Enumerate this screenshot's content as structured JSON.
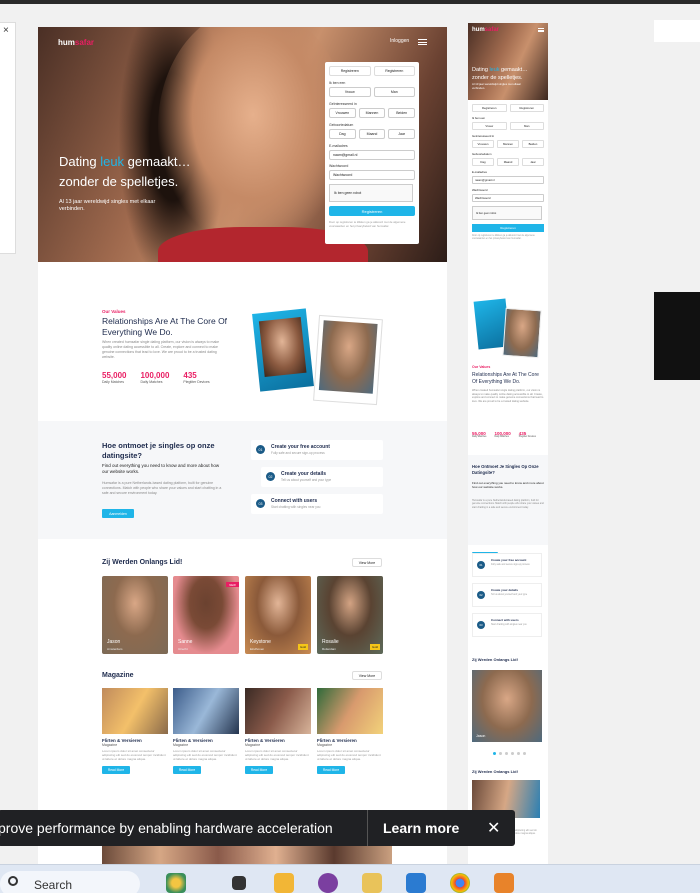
{
  "browser": {
    "close_glyph": "×"
  },
  "site": {
    "logo_main": "hum",
    "logo_accent": "safar",
    "login_label": "Inloggen",
    "hero_title_pre": "Dating ",
    "hero_title_highlight": "leuk",
    "hero_title_post": " gemaakt…",
    "hero_title_line2": "zonder de spelletjes.",
    "hero_sub": "Al 13 jaar wereldwijd singles met elkaar verbinden.",
    "form": {
      "social_btn_1": "Registreren",
      "social_btn_2": "Registreren",
      "label_iam": "Ik ben een",
      "iam_options": [
        "Vrouw",
        "Man"
      ],
      "label_interested": "Geïnteresseerd in",
      "interested_options": [
        "Vrouwen",
        "Mannen",
        "Beiden"
      ],
      "label_dob": "Geboortedatum",
      "dob_day": "Dag",
      "dob_month": "Maand",
      "dob_year": "Jaar",
      "label_email": "E-mailadres",
      "email_value": "naam@gmail.nl",
      "label_password": "Wachtwoord",
      "password_value": "Wachtwoord",
      "captcha_label": "Ik ben geen robot",
      "register_label": "Registreren",
      "fine_print": "Door op registreren te klikken ga je akkoord met de algemene voorwaarden en het privacybeleid van humsafar."
    },
    "values": {
      "eyebrow": "Our Values",
      "title": "Relationships Are At The Core Of Everything We Do.",
      "text": "When created humsafar single dating platform, our vision is always to make quality online dating accessible to all. Create, explore and connect to make genuine connections that lead to love. We are proud to be a trusted dating website.",
      "stats": [
        {
          "num": "55,000",
          "label": "Daily Matches"
        },
        {
          "num": "100,000",
          "label": "Daily Matches"
        },
        {
          "num": "435",
          "label": "Plegtiter Devices"
        }
      ]
    },
    "how": {
      "title": "Hoe ontmoet je singles op onze datingsite?",
      "lead": "Find out everything you need to know and more about how our website works.",
      "text": "Humsafar is a pure Netherlands-based dating platform, built for genuine connections. Match with people who share your values and start chatting in a safe and secure environment today.",
      "button": "Aanmelden",
      "steps": [
        {
          "n": "01",
          "title": "Create your free account",
          "desc": "Fully safe and secure sign-up process"
        },
        {
          "n": "02",
          "title": "Create your details",
          "desc": "Tell us about yourself and your type"
        },
        {
          "n": "03",
          "title": "Connect with users",
          "desc": "Start chatting with singles near you"
        }
      ]
    },
    "members": {
      "title": "Zij Werden Onlangs Lid!",
      "view_more": "View More",
      "items": [
        {
          "name": "Jason",
          "city": "Amsterdam",
          "color": "#7c6a56"
        },
        {
          "name": "Sanne",
          "city": "Utrecht",
          "color": "#e58b8f",
          "new": "NEW"
        },
        {
          "name": "Keystone",
          "city": "Eindhoven",
          "color": "#c98b52",
          "tag": "Gold"
        },
        {
          "name": "Rosalie",
          "city": "Rotterdam",
          "color": "#5d6a5a",
          "tag": "Gold"
        }
      ]
    },
    "magazine": {
      "title": "Magazine",
      "view_more": "View More",
      "items": [
        {
          "title": "Flirten & Versieren",
          "cat": "Magazine",
          "desc": "Lorem ipsum dolor sit amet consectetur adipiscing elit sed do eiusmod tempor incididunt ut labore et dolore magna aliqua.",
          "cta": "Read More",
          "color": "#c08b5c"
        },
        {
          "title": "Flirten & Versieren",
          "cat": "Magazine",
          "desc": "Lorem ipsum dolor sit amet consectetur adipiscing elit sed do eiusmod tempor incididunt ut labore et dolore magna aliqua.",
          "cta": "Read More",
          "color": "#3c5c8a"
        },
        {
          "title": "Flirten & Versieren",
          "cat": "Magazine",
          "desc": "Lorem ipsum dolor sit amet consectetur adipiscing elit sed do eiusmod tempor incididunt ut labore et dolore magna aliqua.",
          "cta": "Read More",
          "color": "#8a5a4a"
        },
        {
          "title": "Flirten & Versieren",
          "cat": "Magazine",
          "desc": "Lorem ipsum dolor sit amet consectetur adipiscing elit sed do eiusmod tempor incididunt ut labore et dolore magna aliqua.",
          "cta": "Read More",
          "color": "#d89a6e"
        }
      ]
    }
  },
  "mobile": {
    "hero_title_pre": "Dating ",
    "hero_title_highlight": "leuk",
    "hero_title_post": " gemaakt…",
    "hero_title_line2": "zonder de spelletjes.",
    "hero_sub": "Al 13 jaar wereldwijd singles met elkaar verbinden.",
    "values_title": "Relationships Are At The Core Of Everything We Do.",
    "how_title": "Hoe Ontmoet Je Singles Op Onze Datingsite?",
    "how_lead": "Find out everything you need to know and more about how our website works.",
    "member_name": "Jason",
    "members_title": "Zij Werden Onlangs Lid!",
    "magazine_section_title": "Zij Werden Onlangs Lid!",
    "mag_title": "Flirten & Versieren"
  },
  "toast": {
    "message": "prove performance by enabling hardware acceleration",
    "learn_more": "Learn more",
    "close_glyph": "✕"
  },
  "taskbar": {
    "search_label": "Search"
  }
}
